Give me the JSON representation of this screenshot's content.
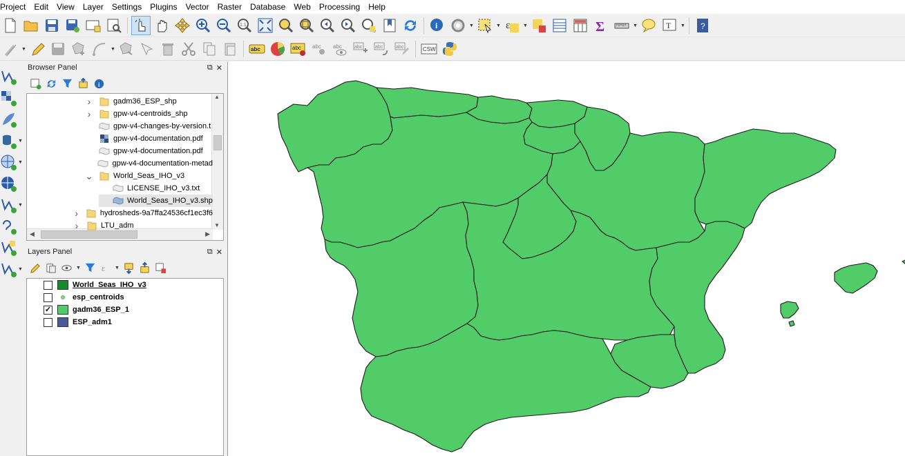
{
  "menu": [
    "Project",
    "Edit",
    "View",
    "Layer",
    "Settings",
    "Plugins",
    "Vector",
    "Raster",
    "Database",
    "Web",
    "Processing",
    "Help"
  ],
  "browser_panel": {
    "title": "Browser Panel",
    "items": [
      {
        "label": "gadm36_ESP_shp",
        "type": "folder",
        "expander": ">",
        "indent": 0
      },
      {
        "label": "gpw-v4-centroids_shp",
        "type": "folder",
        "expander": ">",
        "indent": 0
      },
      {
        "label": "gpw-v4-changes-by-version.t",
        "type": "file",
        "expander": "",
        "indent": 0
      },
      {
        "label": "gpw-v4-documentation.pdf",
        "type": "raster",
        "expander": "",
        "indent": 0
      },
      {
        "label": "gpw-v4-documentation.pdf",
        "type": "file",
        "expander": "",
        "indent": 0
      },
      {
        "label": "gpw-v4-documentation-metad",
        "type": "file",
        "expander": "",
        "indent": 0
      },
      {
        "label": "World_Seas_IHO_v3",
        "type": "folder",
        "expander": "v",
        "indent": 0
      },
      {
        "label": "LICENSE_IHO_v3.txt",
        "type": "file",
        "expander": "",
        "indent": 1
      },
      {
        "label": "World_Seas_IHO_v3.shp",
        "type": "vector",
        "expander": "",
        "indent": 1,
        "selected": true
      },
      {
        "label": "hydrosheds-9a7ffa24536cf1ec3f6",
        "type": "folder",
        "expander": ">",
        "indent": -1
      },
      {
        "label": "LTU_adm",
        "type": "folder",
        "expander": ">",
        "indent": -1
      }
    ]
  },
  "layers_panel": {
    "title": "Layers Panel",
    "layers": [
      {
        "name": "World_Seas_IHO_v3",
        "checked": false,
        "color": "#168a2c",
        "symbol": "fill",
        "underline": true
      },
      {
        "name": "esp_centroids",
        "checked": false,
        "color": "#8fd18f",
        "symbol": "point",
        "underline": false
      },
      {
        "name": "gadm36_ESP_1",
        "checked": true,
        "color": "#52cc68",
        "symbol": "fill",
        "underline": false
      },
      {
        "name": "ESP_adm1",
        "checked": false,
        "color": "#4a5a9a",
        "symbol": "fill",
        "underline": false
      }
    ]
  },
  "map": {
    "fill_color": "#52cc68",
    "stroke_color": "#1a1a1a",
    "background": "#ffffff"
  },
  "toolbar_text": {
    "csw": "CSW",
    "abc": "abc"
  }
}
